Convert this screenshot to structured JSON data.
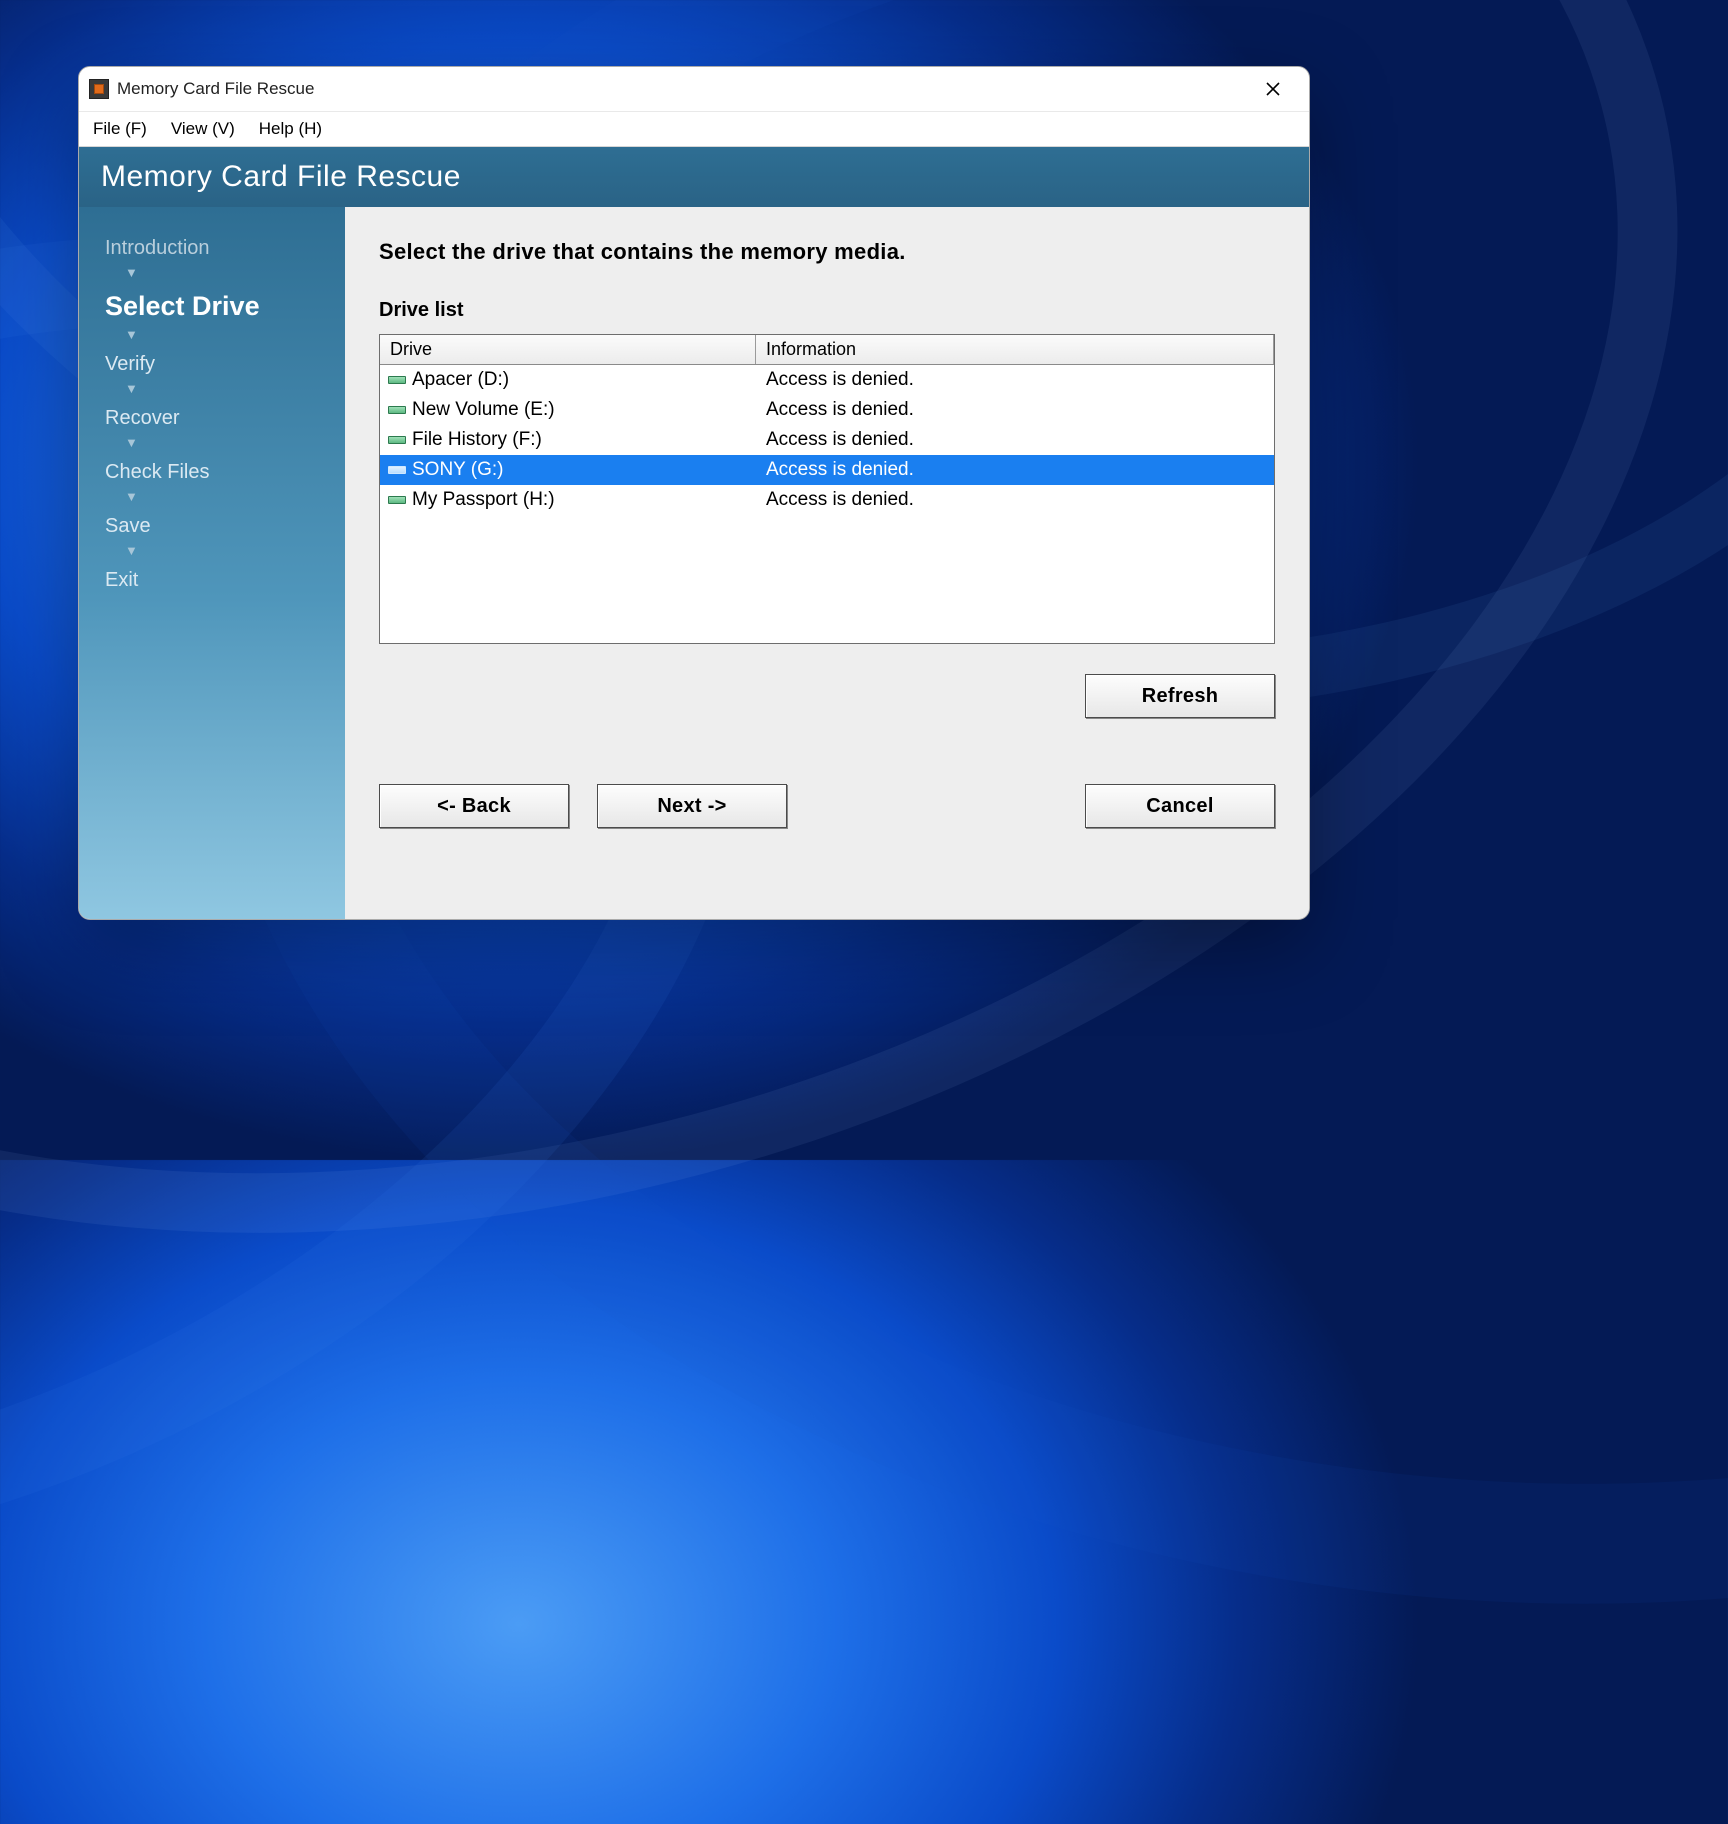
{
  "window": {
    "title": "Memory Card File Rescue"
  },
  "menu": {
    "file": "File (F)",
    "view": "View (V)",
    "help": "Help (H)"
  },
  "banner": {
    "title": "Memory Card File Rescue"
  },
  "sidebar": {
    "steps": [
      {
        "label": "Introduction",
        "state": "done"
      },
      {
        "label": "Select Drive",
        "state": "current"
      },
      {
        "label": "Verify",
        "state": ""
      },
      {
        "label": "Recover",
        "state": ""
      },
      {
        "label": "Check Files",
        "state": ""
      },
      {
        "label": "Save",
        "state": ""
      },
      {
        "label": "Exit",
        "state": ""
      }
    ]
  },
  "main": {
    "instruction": "Select the drive that contains the memory media.",
    "list_label": "Drive list",
    "columns": {
      "drive": "Drive",
      "info": "Information"
    },
    "drives": [
      {
        "name": "Apacer (D:)",
        "info": "Access is denied.",
        "selected": false
      },
      {
        "name": "New Volume (E:)",
        "info": "Access is denied.",
        "selected": false
      },
      {
        "name": "File History (F:)",
        "info": "Access is denied.",
        "selected": false
      },
      {
        "name": "SONY (G:)",
        "info": "Access is denied.",
        "selected": true
      },
      {
        "name": "My Passport (H:)",
        "info": "Access is denied.",
        "selected": false
      }
    ],
    "buttons": {
      "refresh": "Refresh",
      "back": "<- Back",
      "next": "Next ->",
      "cancel": "Cancel"
    }
  }
}
